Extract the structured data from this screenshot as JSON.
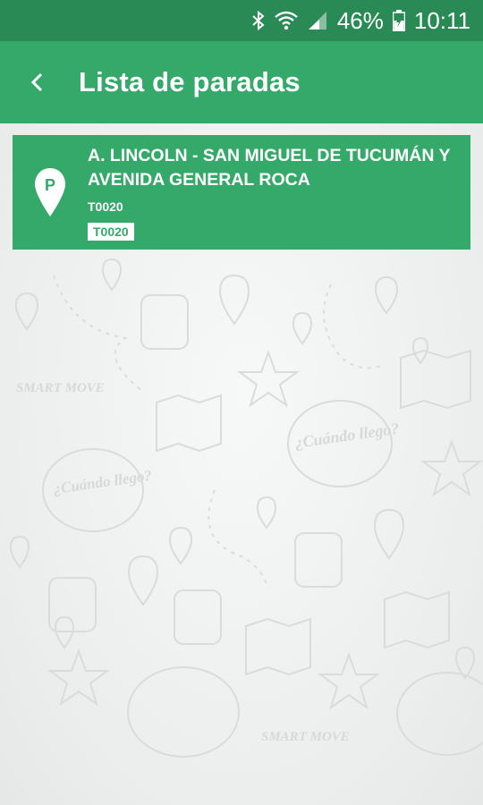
{
  "status_bar": {
    "battery_percent": "46%",
    "time": "10:11",
    "icons": [
      "bluetooth-icon",
      "wifi-icon",
      "signal-icon",
      "battery-charging-icon"
    ]
  },
  "app_bar": {
    "back_icon": "chevron-left-icon",
    "title": "Lista de paradas"
  },
  "stops": [
    {
      "name": "A. LINCOLN - SAN MIGUEL DE TUCUMÁN Y AVENIDA GENERAL ROCA",
      "code": "T0020",
      "badge": "T0020",
      "icon": "map-pin-parking-icon"
    }
  ],
  "background": {
    "pattern_text_1": "SMART MOVE",
    "pattern_text_2": "¿Cuándo llego?"
  },
  "colors": {
    "status_bar": "#2a8a55",
    "app_bar": "#35a96a",
    "card": "#35a96a",
    "background": "#eceeee"
  }
}
